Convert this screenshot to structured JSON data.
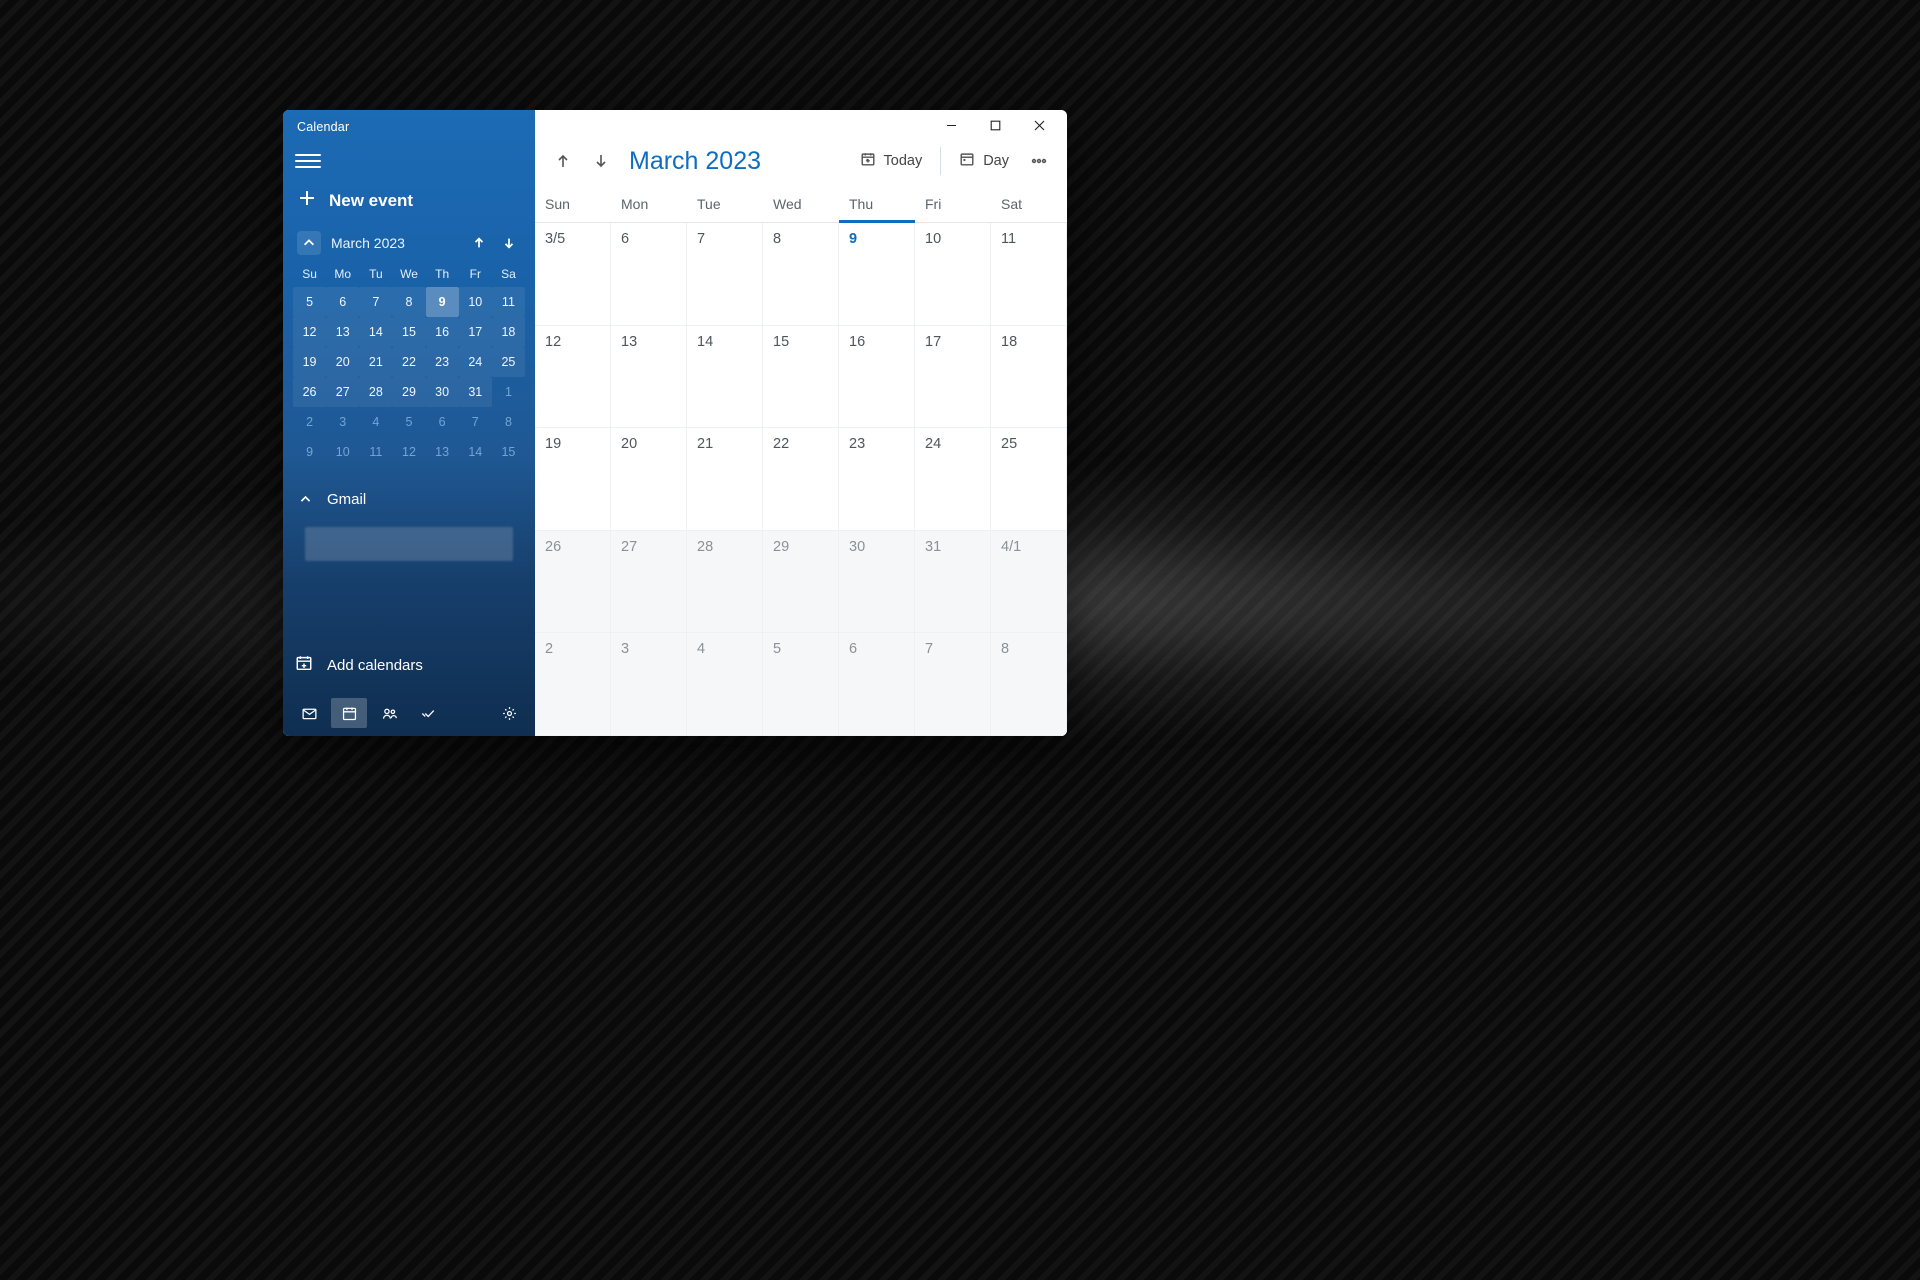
{
  "app": {
    "title": "Calendar"
  },
  "window_controls": {
    "minimize": "–",
    "maximize": "▢",
    "close": "✕"
  },
  "sidebar": {
    "new_event_label": "New event",
    "mini": {
      "month_label": "March 2023",
      "dow": [
        "Su",
        "Mo",
        "Tu",
        "We",
        "Th",
        "Fr",
        "Sa"
      ],
      "cells": [
        {
          "t": "5",
          "shade": true
        },
        {
          "t": "6",
          "shade": true
        },
        {
          "t": "7",
          "shade": true
        },
        {
          "t": "8",
          "shade": true
        },
        {
          "t": "9",
          "shade": true,
          "today": true
        },
        {
          "t": "10",
          "shade": true
        },
        {
          "t": "11",
          "shade": true
        },
        {
          "t": "12",
          "shade": true
        },
        {
          "t": "13",
          "shade": true
        },
        {
          "t": "14",
          "shade": true
        },
        {
          "t": "15",
          "shade": true
        },
        {
          "t": "16",
          "shade": true
        },
        {
          "t": "17",
          "shade": true
        },
        {
          "t": "18",
          "shade": true
        },
        {
          "t": "19",
          "shade": true
        },
        {
          "t": "20",
          "shade": true
        },
        {
          "t": "21",
          "shade": true
        },
        {
          "t": "22",
          "shade": true
        },
        {
          "t": "23",
          "shade": true
        },
        {
          "t": "24",
          "shade": true
        },
        {
          "t": "25",
          "shade": true
        },
        {
          "t": "26",
          "shade": true
        },
        {
          "t": "27",
          "shade": true
        },
        {
          "t": "28",
          "shade": true
        },
        {
          "t": "29",
          "shade": true
        },
        {
          "t": "30",
          "shade": true
        },
        {
          "t": "31",
          "shade": true
        },
        {
          "t": "1",
          "other": true
        },
        {
          "t": "2",
          "other": true
        },
        {
          "t": "3",
          "other": true
        },
        {
          "t": "4",
          "other": true
        },
        {
          "t": "5",
          "other": true
        },
        {
          "t": "6",
          "other": true
        },
        {
          "t": "7",
          "other": true
        },
        {
          "t": "8",
          "other": true
        },
        {
          "t": "9",
          "other": true
        },
        {
          "t": "10",
          "other": true
        },
        {
          "t": "11",
          "other": true
        },
        {
          "t": "12",
          "other": true
        },
        {
          "t": "13",
          "other": true
        },
        {
          "t": "14",
          "other": true
        },
        {
          "t": "15",
          "other": true
        }
      ]
    },
    "account_label": "Gmail",
    "add_calendars_label": "Add calendars"
  },
  "toolbar": {
    "month_label": "March 2023",
    "today_label": "Today",
    "view_label": "Day"
  },
  "main_grid": {
    "dow": [
      "Sun",
      "Mon",
      "Tue",
      "Wed",
      "Thu",
      "Fri",
      "Sat"
    ],
    "today_col_index": 4,
    "cells": [
      {
        "t": "3/5"
      },
      {
        "t": "6"
      },
      {
        "t": "7"
      },
      {
        "t": "8"
      },
      {
        "t": "9",
        "today": true
      },
      {
        "t": "10"
      },
      {
        "t": "11"
      },
      {
        "t": "12"
      },
      {
        "t": "13"
      },
      {
        "t": "14"
      },
      {
        "t": "15"
      },
      {
        "t": "16"
      },
      {
        "t": "17"
      },
      {
        "t": "18"
      },
      {
        "t": "19"
      },
      {
        "t": "20"
      },
      {
        "t": "21"
      },
      {
        "t": "22"
      },
      {
        "t": "23"
      },
      {
        "t": "24"
      },
      {
        "t": "25"
      },
      {
        "t": "26",
        "dim": true
      },
      {
        "t": "27",
        "dim": true
      },
      {
        "t": "28",
        "dim": true
      },
      {
        "t": "29",
        "dim": true
      },
      {
        "t": "30",
        "dim": true
      },
      {
        "t": "31",
        "dim": true
      },
      {
        "t": "4/1",
        "dim": true
      },
      {
        "t": "2",
        "dim": true
      },
      {
        "t": "3",
        "dim": true
      },
      {
        "t": "4",
        "dim": true
      },
      {
        "t": "5",
        "dim": true
      },
      {
        "t": "6",
        "dim": true
      },
      {
        "t": "7",
        "dim": true
      },
      {
        "t": "8",
        "dim": true
      }
    ]
  }
}
